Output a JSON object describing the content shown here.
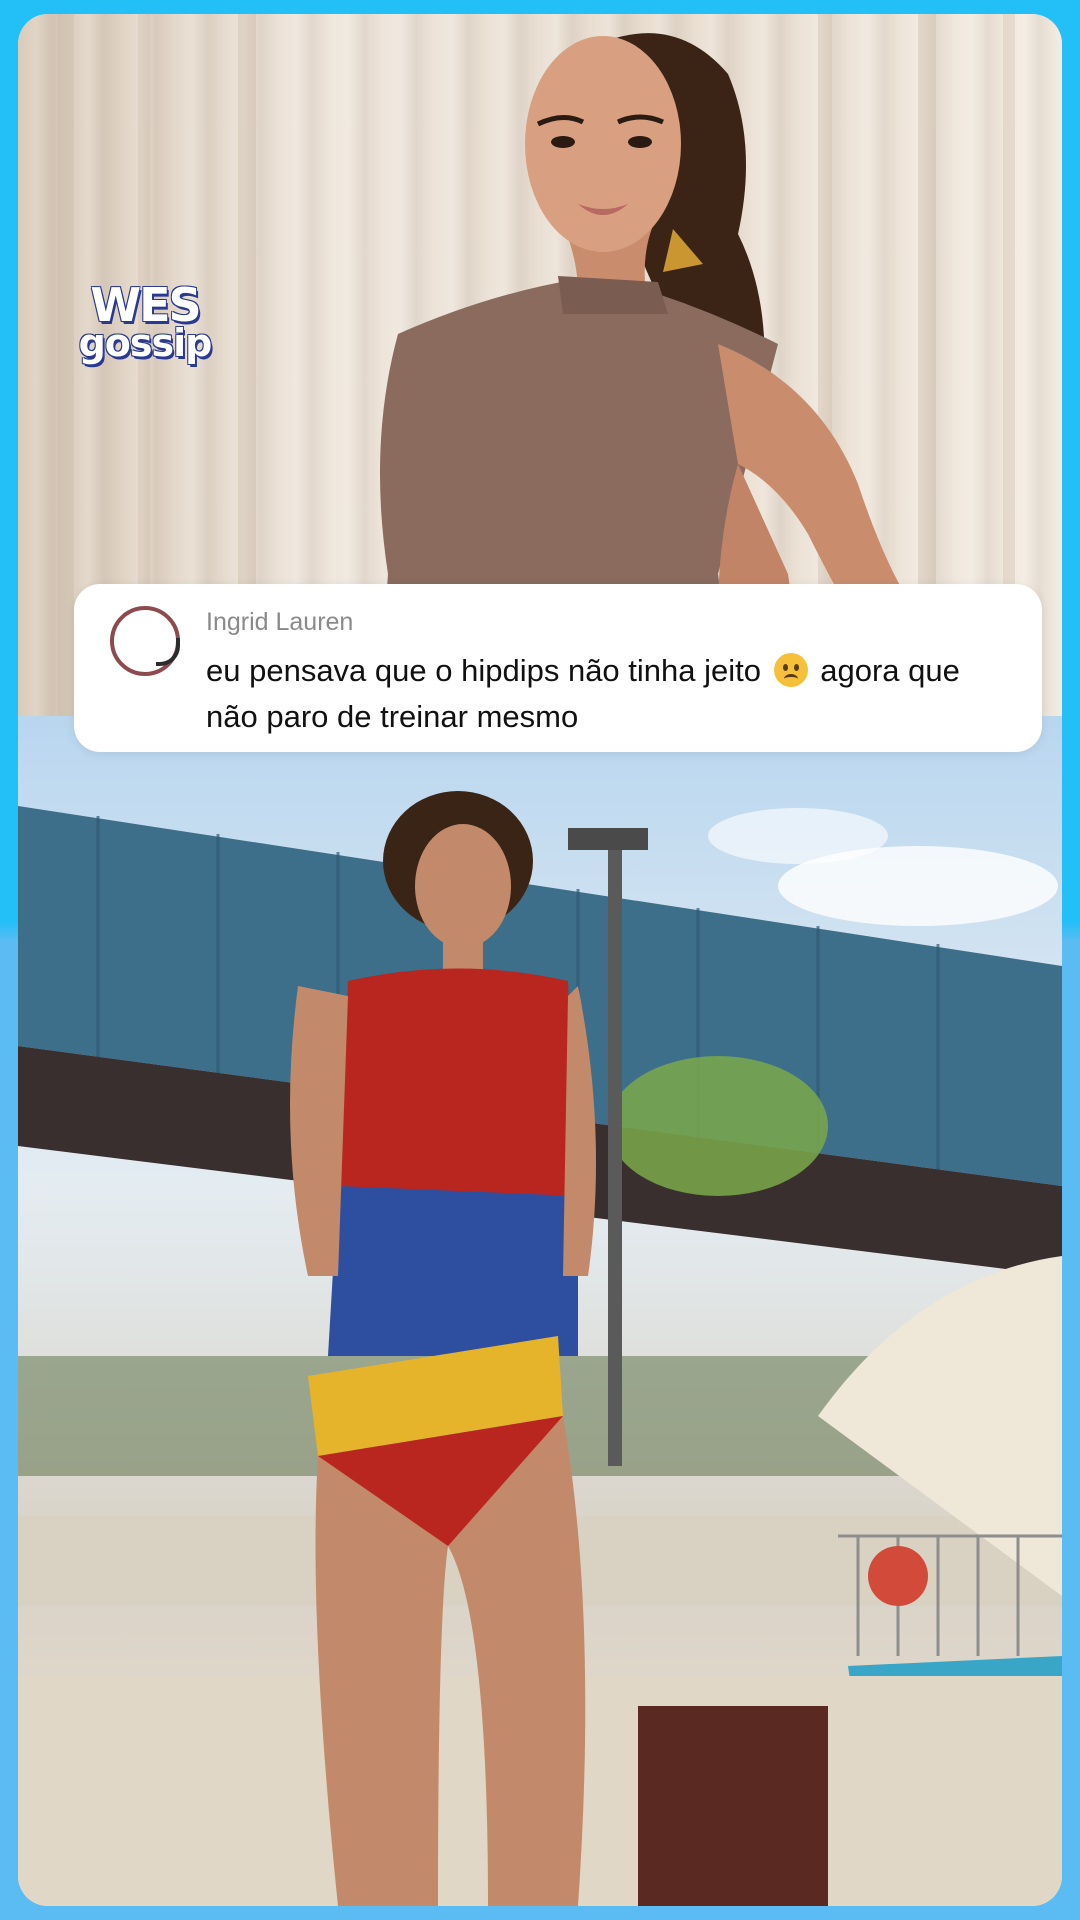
{
  "brand": {
    "line1": "WES",
    "line2": "gossip"
  },
  "comment": {
    "username": "Ingrid Lauren",
    "text_before_emoji": "eu pensava que o hipdips não tinha jeito",
    "emoji": "worried-face-emoji",
    "text_after_emoji": "agora que não paro de treinar mesmo"
  },
  "colors": {
    "frame_top": "#23bff7",
    "frame_bottom": "#5bbcf3",
    "card_bg": "#ffffff",
    "username_color": "#8a8a8a",
    "avatar_ring": "#8e4a4e"
  }
}
